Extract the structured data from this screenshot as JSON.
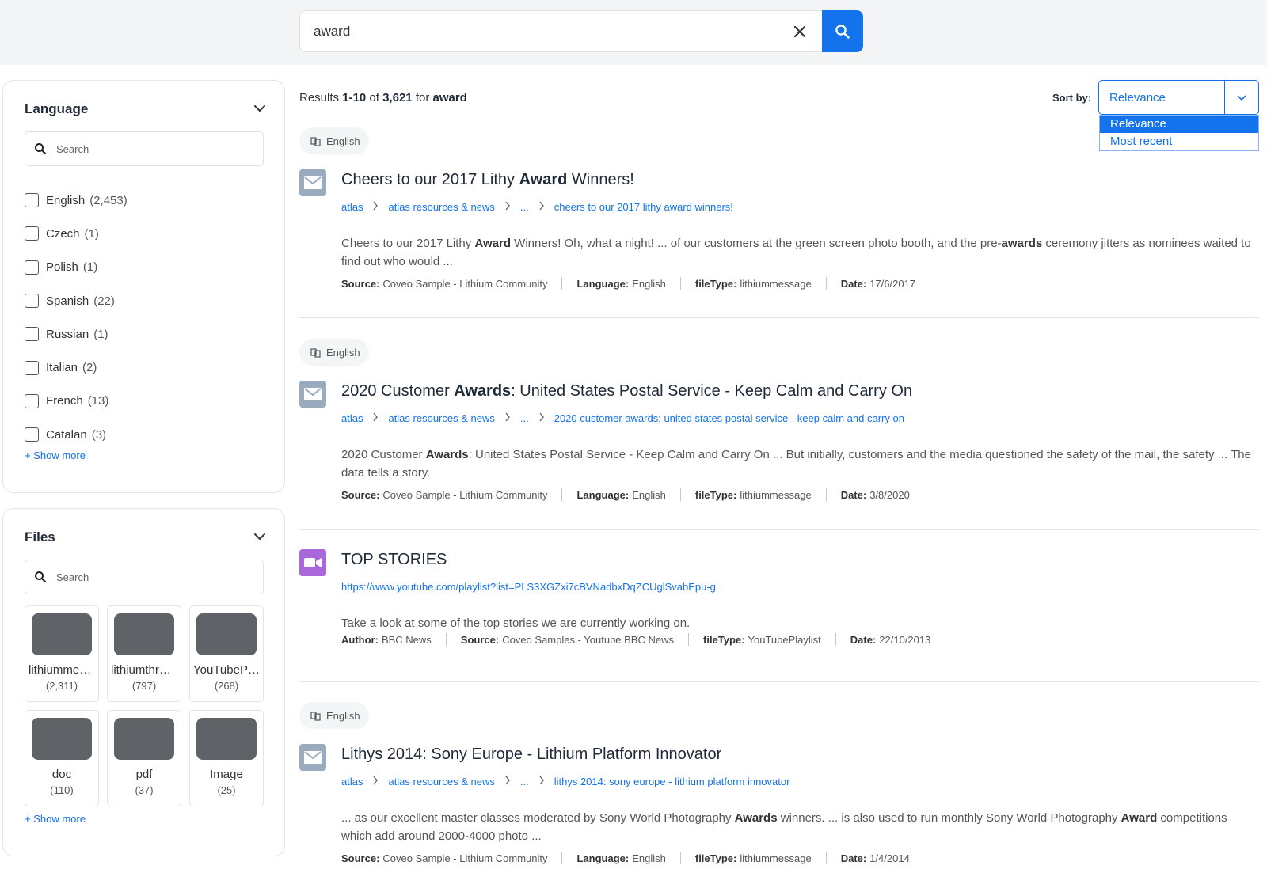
{
  "search": {
    "query": "award"
  },
  "language_facet": {
    "title": "Language",
    "search_placeholder": "Search",
    "items": [
      {
        "label": "English",
        "count": "(2,453)"
      },
      {
        "label": "Czech",
        "count": "(1)"
      },
      {
        "label": "Polish",
        "count": "(1)"
      },
      {
        "label": "Spanish",
        "count": "(22)"
      },
      {
        "label": "Russian",
        "count": "(1)"
      },
      {
        "label": "Italian",
        "count": "(2)"
      },
      {
        "label": "French",
        "count": "(13)"
      },
      {
        "label": "Catalan",
        "count": "(3)"
      }
    ],
    "show_more": "Show more"
  },
  "files_facet": {
    "title": "Files",
    "search_placeholder": "Search",
    "tiles": [
      {
        "label": "lithiummessage",
        "count": "(2,311)"
      },
      {
        "label": "lithiumthread",
        "count": "(797)"
      },
      {
        "label": "YouTubePlaylist",
        "count": "(268)"
      },
      {
        "label": "doc",
        "count": "(110)"
      },
      {
        "label": "pdf",
        "count": "(37)"
      },
      {
        "label": "Image",
        "count": "(25)"
      }
    ],
    "show_more": "Show more"
  },
  "summary": {
    "prefix": "Results",
    "range": "1-10",
    "of": "of",
    "total": "3,621",
    "for": "for",
    "query": "award"
  },
  "sort": {
    "label": "Sort by:",
    "selected": "Relevance",
    "options": [
      "Relevance",
      "Most recent"
    ]
  },
  "results": [
    {
      "badge": "English",
      "icon": "envelope-icon",
      "title": {
        "pre": "Cheers to our 2017 Lithy ",
        "bold": "Award",
        "post": " Winners!"
      },
      "crumbs": [
        "atlas",
        "atlas resources & news",
        "...",
        "cheers to our 2017 lithy award winners!"
      ],
      "excerpt": [
        {
          "t": "Cheers to our 2017 Lithy "
        },
        {
          "b": "Award"
        },
        {
          "t": " Winners! Oh, what a night! ... of our customers at the green screen photo booth, and the pre-"
        },
        {
          "b": "awards"
        },
        {
          "t": " ceremony jitters as nominees waited to find out who would ..."
        }
      ],
      "fields": [
        {
          "k": "Source:",
          "v": "Coveo Sample - Lithium Community"
        },
        {
          "k": "Language:",
          "v": "English"
        },
        {
          "k": "fileType:",
          "v": "lithiummessage"
        },
        {
          "k": "Date:",
          "v": "17/6/2017"
        }
      ]
    },
    {
      "badge": "English",
      "icon": "envelope-icon",
      "title": {
        "pre": "2020 Customer ",
        "bold": "Awards",
        "post": ": United States Postal Service - Keep Calm and Carry On"
      },
      "crumbs": [
        "atlas",
        "atlas resources & news",
        "...",
        "2020 customer awards: united states postal service - keep calm and carry on"
      ],
      "excerpt": [
        {
          "t": "2020 Customer "
        },
        {
          "b": "Awards"
        },
        {
          "t": ": United States Postal Service - Keep Calm and Carry On ... But initially, customers and the media questioned the safety of the mail, the safety ... The data tells a story."
        }
      ],
      "fields": [
        {
          "k": "Source:",
          "v": "Coveo Sample - Lithium Community"
        },
        {
          "k": "Language:",
          "v": "English"
        },
        {
          "k": "fileType:",
          "v": "lithiummessage"
        },
        {
          "k": "Date:",
          "v": "3/8/2020"
        }
      ]
    },
    {
      "badge": "",
      "icon": "video-camera-icon",
      "title": {
        "pre": "TOP STORIES",
        "bold": "",
        "post": ""
      },
      "url": "https://www.youtube.com/playlist?list=PLS3XGZxi7cBVNadbxDqZCUglSvabEpu-g",
      "excerpt": [
        {
          "t": "Take a look at some of the top stories we are currently working on."
        }
      ],
      "fields": [
        {
          "k": "Author:",
          "v": "BBC News"
        },
        {
          "k": "Source:",
          "v": "Coveo Samples - Youtube BBC News"
        },
        {
          "k": "fileType:",
          "v": "YouTubePlaylist"
        },
        {
          "k": "Date:",
          "v": "22/10/2013"
        }
      ]
    },
    {
      "badge": "English",
      "icon": "envelope-icon",
      "title": {
        "pre": "Lithys 2014: Sony Europe - Lithium Platform Innovator",
        "bold": "",
        "post": ""
      },
      "crumbs": [
        "atlas",
        "atlas resources & news",
        "...",
        "lithys 2014: sony europe - lithium platform innovator"
      ],
      "excerpt": [
        {
          "t": "... as our excellent master classes moderated by Sony World Photography "
        },
        {
          "b": "Awards"
        },
        {
          "t": " winners. ... is also used to run monthly Sony World Photography "
        },
        {
          "b": "Award"
        },
        {
          "t": " competitions which add around 2000-4000 photo ..."
        }
      ],
      "fields": [
        {
          "k": "Source:",
          "v": "Coveo Sample - Lithium Community"
        },
        {
          "k": "Language:",
          "v": "English"
        },
        {
          "k": "fileType:",
          "v": "lithiummessage"
        },
        {
          "k": "Date:",
          "v": "1/4/2014"
        }
      ]
    }
  ],
  "colors": {
    "accent": "#1372ec",
    "envelope_bg": "#9aabc0",
    "video_bg": "#a969db",
    "tile_thumb": "#5f6368"
  }
}
